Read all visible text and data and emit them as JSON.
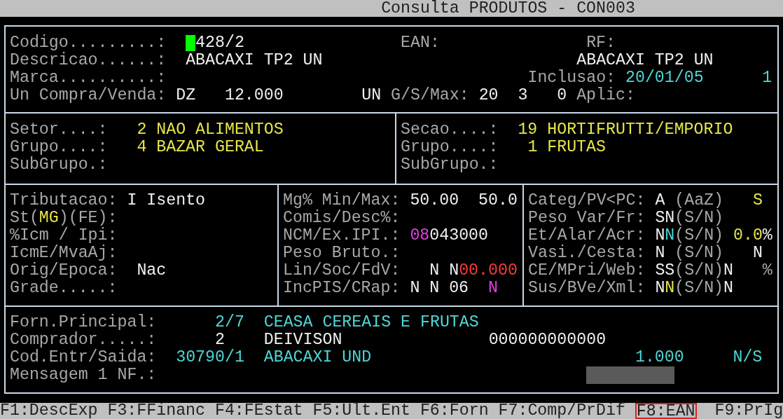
{
  "window": {
    "title": "Consulta PRODUTOS - CON003"
  },
  "sections": [
    {
      "panels": [
        {
          "lines": [
            [
              {
                "text": "Codigo.........:",
                "color": "#a8a8a8"
              },
              {
                "text": "428/2",
                "color": "#f0f0f0"
              },
              {
                "text": "EAN:",
                "color": "#a8a8a8"
              },
              {
                "text": "RF:",
                "color": "#a8a8a8"
              }
            ],
            [
              {
                "text": "Descricao......:",
                "color": "#a8a8a8"
              },
              {
                "text": "ABACAXI TP2 UN",
                "color": "#f0f0f0"
              },
              {
                "text": "ABACAXI TP2 UN",
                "color": "#f0f0f0"
              }
            ],
            [
              {
                "text": "Marca..........:",
                "color": "#a8a8a8"
              },
              {
                "text": "Inclusao:",
                "color": "#a8a8a8"
              },
              {
                "text": "20/01/05",
                "color": "#4fd6d6"
              },
              {
                "text": "1",
                "color": "#4fd6d6"
              }
            ],
            [
              {
                "text": "Un Compra/Venda:",
                "color": "#a8a8a8"
              },
              {
                "text": "DZ",
                "color": "#f0f0f0"
              },
              {
                "text": "12.000",
                "color": "#f0f0f0"
              },
              {
                "text": "UN",
                "color": "#f0f0f0"
              },
              {
                "text": "G/S/Max:",
                "color": "#a8a8a8"
              },
              {
                "text": "20",
                "color": "#f0f0f0"
              },
              {
                "text": "3",
                "color": "#f0f0f0"
              },
              {
                "text": "0",
                "color": "#f0f0f0"
              },
              {
                "text": "Aplic:",
                "color": "#a8a8a8"
              }
            ]
          ]
        }
      ]
    },
    {
      "panels": [
        {
          "lines": [
            [
              {
                "text": "Setor....:",
                "color": "#a8a8a8"
              },
              {
                "text": "2",
                "color": "#e6e64a"
              },
              {
                "text": "NAO ALIMENTOS",
                "color": "#e6e64a"
              }
            ],
            [
              {
                "text": "Grupo....:",
                "color": "#a8a8a8"
              },
              {
                "text": "4",
                "color": "#e6e64a"
              },
              {
                "text": "BAZAR GERAL",
                "color": "#e6e64a"
              }
            ],
            [
              {
                "text": "SubGrupo.:",
                "color": "#a8a8a8"
              }
            ]
          ]
        },
        {
          "lines": [
            [
              {
                "text": "Secao....:",
                "color": "#a8a8a8"
              },
              {
                "text": "19",
                "color": "#e6e64a"
              },
              {
                "text": "HORTIFRUTTI/EMPORIO",
                "color": "#e6e64a"
              }
            ],
            [
              {
                "text": "Grupo....:",
                "color": "#a8a8a8"
              },
              {
                "text": "1",
                "color": "#e6e64a"
              },
              {
                "text": "FRUTAS",
                "color": "#e6e64a"
              }
            ],
            [
              {
                "text": "SubGrupo.:",
                "color": "#a8a8a8"
              }
            ]
          ]
        }
      ]
    },
    {
      "panels": [
        {
          "lines": [
            [
              {
                "text": "Tributacao:",
                "color": "#a8a8a8"
              },
              {
                "text": "I Isento",
                "color": "#f0f0f0"
              }
            ],
            [
              {
                "text": "St(",
                "color": "#a8a8a8"
              },
              {
                "text": "MG",
                "color": "#e6e64a"
              },
              {
                "text": ")(FE):",
                "color": "#a8a8a8"
              }
            ],
            [
              {
                "text": "%Icm / Ipi:",
                "color": "#a8a8a8"
              }
            ],
            [
              {
                "text": "IcmE/MvaAj:",
                "color": "#a8a8a8"
              }
            ],
            [
              {
                "text": "Orig/Epoca:",
                "color": "#a8a8a8"
              },
              {
                "text": "Nac",
                "color": "#f0f0f0"
              }
            ],
            [
              {
                "text": "Grade.....:",
                "color": "#a8a8a8"
              }
            ]
          ]
        },
        {
          "lines": [
            [
              {
                "text": "Mg% Min/Max:",
                "color": "#a8a8a8"
              },
              {
                "text": "50.00",
                "color": "#f0f0f0"
              },
              {
                "text": "50.0",
                "color": "#f0f0f0"
              }
            ],
            [
              {
                "text": "Comis/Desc%:",
                "color": "#a8a8a8"
              }
            ],
            [
              {
                "text": "NCM/Ex.IPI.:",
                "color": "#a8a8a8"
              },
              {
                "text": "08",
                "color": "#e040e0"
              },
              {
                "text": "043000",
                "color": "#f0f0f0"
              }
            ],
            [
              {
                "text": "Peso Bruto.:",
                "color": "#a8a8a8"
              }
            ],
            [
              {
                "text": "Lin/Soc/FdV:",
                "color": "#a8a8a8"
              },
              {
                "text": "N",
                "color": "#f0f0f0"
              },
              {
                "text": "N",
                "color": "#f0f0f0"
              },
              {
                "text": "00.000",
                "color": "#ff3a3a"
              }
            ],
            [
              {
                "text": "IncPIS/CRap:",
                "color": "#a8a8a8"
              },
              {
                "text": "N",
                "color": "#f0f0f0"
              },
              {
                "text": "N",
                "color": "#f0f0f0"
              },
              {
                "text": "06",
                "color": "#f0f0f0"
              },
              {
                "text": "N",
                "color": "#e040e0"
              }
            ]
          ]
        },
        {
          "lines": [
            [
              {
                "text": "Categ/PV<PC:",
                "color": "#a8a8a8"
              },
              {
                "text": "A",
                "color": "#f0f0f0"
              },
              {
                "text": "(AaZ)",
                "color": "#a8a8a8"
              },
              {
                "text": "S",
                "color": "#e6e64a"
              }
            ],
            [
              {
                "text": "Peso Var/Fr:",
                "color": "#a8a8a8"
              },
              {
                "text": "SN",
                "color": "#f0f0f0"
              },
              {
                "text": "(S/N)",
                "color": "#a8a8a8"
              }
            ],
            [
              {
                "text": "Et/Alar/Acr:",
                "color": "#a8a8a8"
              },
              {
                "text": "N",
                "color": "#f0f0f0"
              },
              {
                "text": "N",
                "color": "#4fd6d6"
              },
              {
                "text": "(S/N)",
                "color": "#a8a8a8"
              },
              {
                "text": "0.0",
                "color": "#e6e64a"
              },
              {
                "text": "%",
                "color": "#f0f0f0"
              }
            ],
            [
              {
                "text": "Vasi./Cesta:",
                "color": "#a8a8a8"
              },
              {
                "text": "N",
                "color": "#f0f0f0"
              },
              {
                "text": "(S/N)",
                "color": "#a8a8a8"
              },
              {
                "text": "N",
                "color": "#f0f0f0"
              }
            ],
            [
              {
                "text": "CE/MPri/Web:",
                "color": "#a8a8a8"
              },
              {
                "text": "SS",
                "color": "#f0f0f0"
              },
              {
                "text": "(S/N)",
                "color": "#a8a8a8"
              },
              {
                "text": "N",
                "color": "#f0f0f0"
              },
              {
                "text": "%",
                "color": "#a8a8a8"
              }
            ],
            [
              {
                "text": "Sus/BVe/Xml:",
                "color": "#a8a8a8"
              },
              {
                "text": "N",
                "color": "#f0f0f0"
              },
              {
                "text": "N",
                "color": "#e6e64a"
              },
              {
                "text": "(S/N)",
                "color": "#a8a8a8"
              },
              {
                "text": "N",
                "color": "#f0f0f0"
              }
            ]
          ]
        }
      ]
    },
    {
      "panels": [
        {
          "lines": [
            [
              {
                "text": "Forn.Principal:",
                "color": "#a8a8a8"
              },
              {
                "text": "2/7",
                "color": "#4fd6d6"
              },
              {
                "text": "CEASA CEREAIS E FRUTAS",
                "color": "#4fd6d6"
              }
            ],
            [
              {
                "text": "Comprador.....:",
                "color": "#a8a8a8"
              },
              {
                "text": "2",
                "color": "#f0f0f0"
              },
              {
                "text": "DEIVISON",
                "color": "#f0f0f0"
              },
              {
                "text": "000000000000",
                "color": "#f0f0f0"
              }
            ],
            [
              {
                "text": "Cod.Entr/Saida:",
                "color": "#a8a8a8"
              },
              {
                "text": "30790/1",
                "color": "#4fd6d6"
              },
              {
                "text": "ABACAXI UND",
                "color": "#4fd6d6"
              },
              {
                "text": "1.000",
                "color": "#4fd6d6"
              },
              {
                "text": "N/S",
                "color": "#4fd6d6"
              }
            ],
            [
              {
                "text": "Mensagem 1 NF.:",
                "color": "#a8a8a8"
              }
            ]
          ]
        }
      ]
    }
  ],
  "function_keys": [
    {
      "label": "F1:DescExp",
      "selected": false
    },
    {
      "label": "F3:FFinanc",
      "selected": false
    },
    {
      "label": "F4:FEstat",
      "selected": false
    },
    {
      "label": "F5:Ult.Ent",
      "selected": false
    },
    {
      "label": "F6:Forn",
      "selected": false
    },
    {
      "label": "F7:Comp/PrDif",
      "selected": false
    },
    {
      "label": "F8:EAN",
      "selected": true
    },
    {
      "label": "F9:PrIg",
      "selected": false
    }
  ]
}
